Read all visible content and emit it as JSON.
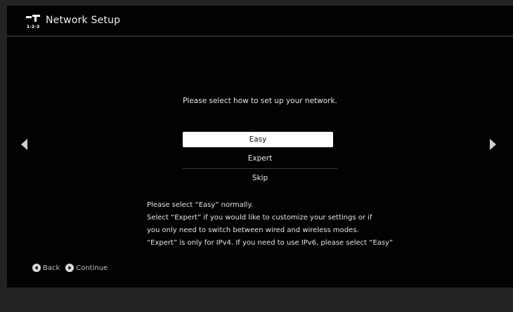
{
  "header": {
    "icon": "network-setup-icon",
    "icon_text": "1·2·3",
    "title": "Network Setup"
  },
  "nav": {
    "left_icon": "left-arrow-icon",
    "right_icon": "right-arrow-icon"
  },
  "prompt": "Please select how to set up your network.",
  "options": [
    {
      "label": "Easy",
      "selected": true
    },
    {
      "label": "Expert",
      "selected": false
    },
    {
      "label": "Skip",
      "selected": false
    }
  ],
  "help": [
    "Please select “Easy” normally.",
    "Select “Expert” if you would like to customize your settings or if",
    "you only need to switch between wired and wireless modes.",
    "“Expert” is only for IPv4. If you need to use IPv6, please select “Easy”"
  ],
  "footer": {
    "back_icon": "circle-left-arrow-icon",
    "back_label": "Back",
    "continue_icon": "circle-right-arrow-icon",
    "continue_label": "Continue"
  },
  "colors": {
    "background": "#020202",
    "outer": "#232323",
    "selected_bg": "#ffffff",
    "text": "#e8e8e8"
  }
}
